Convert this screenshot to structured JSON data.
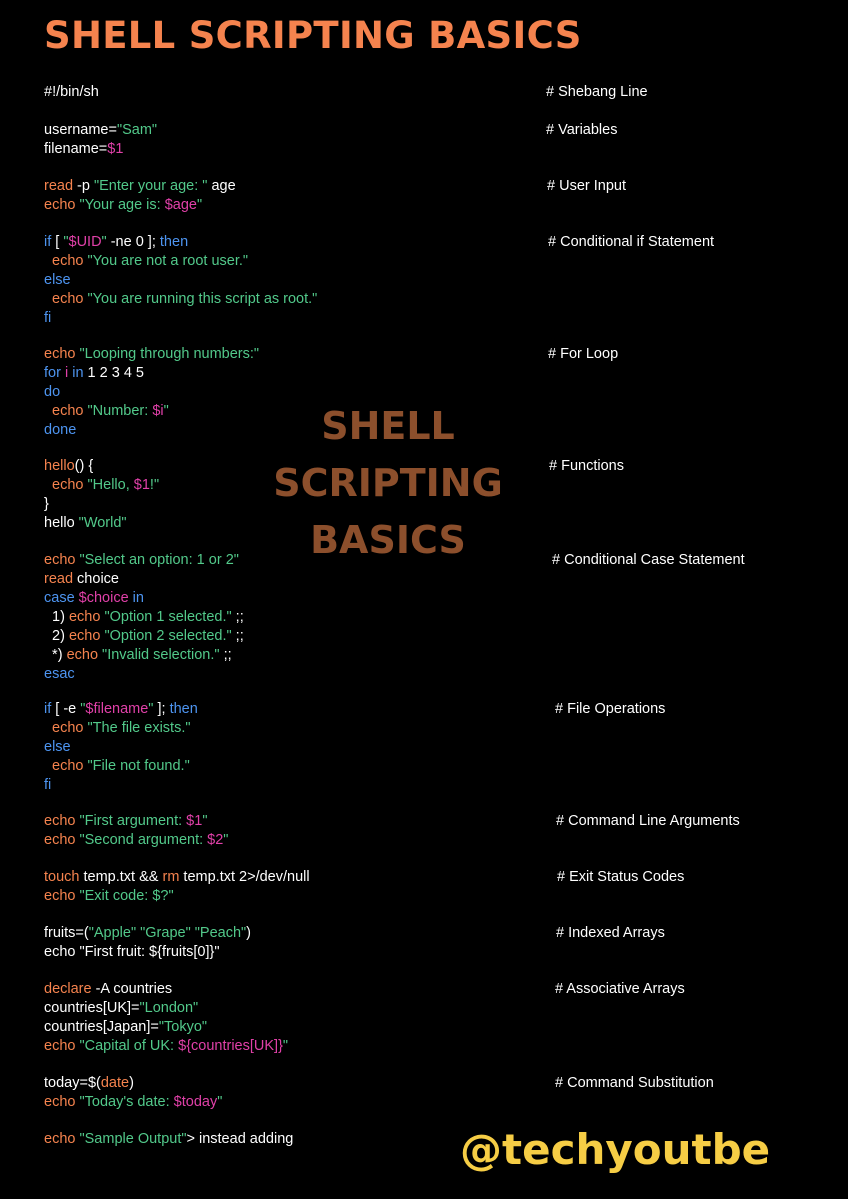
{
  "title": "SHELL SCRIPTING BASICS",
  "watermark": [
    "SHELL",
    "SCRIPTING",
    "BASICS"
  ],
  "handle": "@techyoutbe",
  "colors": {
    "background": "#000000",
    "title": "#f5834e",
    "plain": "#ffffff",
    "command": "#f5834e",
    "string": "#52c98a",
    "variable": "#e040a8",
    "keyword": "#4d94f0",
    "watermark": "#8c4f2c",
    "handle": "#f6cd45"
  },
  "code_lines": [
    {
      "name": "shebang",
      "segments": [
        [
          "w",
          "#!/bin/sh"
        ]
      ]
    },
    {
      "name": "var-username",
      "segments": [
        [
          "w",
          "username="
        ],
        [
          "g",
          "\"Sam\""
        ]
      ]
    },
    {
      "name": "var-filename",
      "segments": [
        [
          "w",
          "filename="
        ],
        [
          "m",
          "$1"
        ]
      ]
    },
    {
      "name": "read-age",
      "segments": [
        [
          "o",
          "read"
        ],
        [
          "w",
          " -p "
        ],
        [
          "g",
          "\"Enter your age: \""
        ],
        [
          "w",
          " age"
        ]
      ]
    },
    {
      "name": "echo-age",
      "segments": [
        [
          "o",
          "echo "
        ],
        [
          "g",
          "\"Your age is: "
        ],
        [
          "m",
          "$age"
        ],
        [
          "g",
          "\""
        ]
      ]
    },
    {
      "name": "if-uid",
      "segments": [
        [
          "b",
          "if"
        ],
        [
          "w",
          " [ "
        ],
        [
          "g",
          "\""
        ],
        [
          "m",
          "$UID"
        ],
        [
          "g",
          "\""
        ],
        [
          "w",
          " -ne 0 ]; "
        ],
        [
          "b",
          "then"
        ]
      ]
    },
    {
      "name": "echo-not-root",
      "segments": [
        [
          "o",
          "  echo "
        ],
        [
          "g",
          "\"You are not a root user.\""
        ]
      ]
    },
    {
      "name": "else-1",
      "segments": [
        [
          "b",
          "else"
        ]
      ]
    },
    {
      "name": "echo-root",
      "segments": [
        [
          "o",
          "  echo "
        ],
        [
          "g",
          "\"You are running this script as root.\""
        ]
      ]
    },
    {
      "name": "fi-1",
      "segments": [
        [
          "b",
          "fi"
        ]
      ]
    },
    {
      "name": "echo-looping",
      "segments": [
        [
          "o",
          "echo "
        ],
        [
          "g",
          "\"Looping through numbers:\""
        ]
      ]
    },
    {
      "name": "for-loop",
      "segments": [
        [
          "b",
          "for"
        ],
        [
          "w",
          " "
        ],
        [
          "m",
          "i"
        ],
        [
          "w",
          " "
        ],
        [
          "b",
          "in"
        ],
        [
          "w",
          " 1 2 3 4 5"
        ]
      ]
    },
    {
      "name": "do",
      "segments": [
        [
          "b",
          "do"
        ]
      ]
    },
    {
      "name": "echo-number",
      "segments": [
        [
          "o",
          "  echo "
        ],
        [
          "g",
          "\"Number: "
        ],
        [
          "m",
          "$i"
        ],
        [
          "g",
          "\""
        ]
      ]
    },
    {
      "name": "done",
      "segments": [
        [
          "b",
          "done"
        ]
      ]
    },
    {
      "name": "func-hello",
      "segments": [
        [
          "o",
          "hello"
        ],
        [
          "w",
          "() {"
        ]
      ]
    },
    {
      "name": "echo-hello",
      "segments": [
        [
          "o",
          "  echo "
        ],
        [
          "g",
          "\"Hello, "
        ],
        [
          "m",
          "$1"
        ],
        [
          "g",
          "!\""
        ]
      ]
    },
    {
      "name": "close-brace",
      "segments": [
        [
          "w",
          "}"
        ]
      ]
    },
    {
      "name": "call-hello",
      "segments": [
        [
          "w",
          "hello "
        ],
        [
          "g",
          "\"World\""
        ]
      ]
    },
    {
      "name": "echo-select",
      "segments": [
        [
          "o",
          "echo "
        ],
        [
          "g",
          "\"Select an option: 1 or 2\""
        ]
      ]
    },
    {
      "name": "read-choice",
      "segments": [
        [
          "o",
          "read"
        ],
        [
          "w",
          " choice"
        ]
      ]
    },
    {
      "name": "case",
      "segments": [
        [
          "b",
          "case "
        ],
        [
          "m",
          "$choice"
        ],
        [
          "b",
          " in"
        ]
      ]
    },
    {
      "name": "case-1",
      "segments": [
        [
          "w",
          "  1) "
        ],
        [
          "o",
          "echo "
        ],
        [
          "g",
          "\"Option 1 selected.\""
        ],
        [
          "w",
          " ;;"
        ]
      ]
    },
    {
      "name": "case-2",
      "segments": [
        [
          "w",
          "  2) "
        ],
        [
          "o",
          "echo "
        ],
        [
          "g",
          "\"Option 2 selected.\""
        ],
        [
          "w",
          " ;;"
        ]
      ]
    },
    {
      "name": "case-default",
      "segments": [
        [
          "w",
          "  *) "
        ],
        [
          "o",
          "echo "
        ],
        [
          "g",
          "\"Invalid selection.\""
        ],
        [
          "w",
          " ;;"
        ]
      ]
    },
    {
      "name": "esac",
      "segments": [
        [
          "b",
          "esac"
        ]
      ]
    },
    {
      "name": "if-file",
      "segments": [
        [
          "b",
          "if"
        ],
        [
          "w",
          " [ -e "
        ],
        [
          "g",
          "\""
        ],
        [
          "m",
          "$filename"
        ],
        [
          "g",
          "\""
        ],
        [
          "w",
          " ]; "
        ],
        [
          "b",
          "then"
        ]
      ]
    },
    {
      "name": "echo-exists",
      "segments": [
        [
          "o",
          "  echo "
        ],
        [
          "g",
          "\"The file exists.\""
        ]
      ]
    },
    {
      "name": "else-2",
      "segments": [
        [
          "b",
          "else"
        ]
      ]
    },
    {
      "name": "echo-not-found",
      "segments": [
        [
          "o",
          "  echo "
        ],
        [
          "g",
          "\"File not found.\""
        ]
      ]
    },
    {
      "name": "fi-2",
      "segments": [
        [
          "b",
          "fi"
        ]
      ]
    },
    {
      "name": "echo-first-arg",
      "segments": [
        [
          "o",
          "echo "
        ],
        [
          "g",
          "\"First argument: "
        ],
        [
          "m",
          "$1"
        ],
        [
          "g",
          "\""
        ]
      ]
    },
    {
      "name": "echo-second-arg",
      "segments": [
        [
          "o",
          "echo "
        ],
        [
          "g",
          "\"Second argument: "
        ],
        [
          "m",
          "$2"
        ],
        [
          "g",
          "\""
        ]
      ]
    },
    {
      "name": "touch-rm",
      "segments": [
        [
          "o",
          "touch"
        ],
        [
          "w",
          " temp.txt && "
        ],
        [
          "o",
          "rm"
        ],
        [
          "w",
          " temp.txt 2>/dev/null"
        ]
      ]
    },
    {
      "name": "echo-exit-code",
      "segments": [
        [
          "o",
          "echo "
        ],
        [
          "g",
          "\"Exit code: $?\""
        ]
      ]
    },
    {
      "name": "fruits-array",
      "segments": [
        [
          "w",
          "fruits=("
        ],
        [
          "g",
          "\"Apple\" \"Grape\" \"Peach\""
        ],
        [
          "w",
          ")"
        ]
      ]
    },
    {
      "name": "echo-first-fruit",
      "segments": [
        [
          "w",
          "echo \"First fruit: ${fruits[0]}\""
        ]
      ]
    },
    {
      "name": "declare",
      "segments": [
        [
          "o",
          "declare"
        ],
        [
          "w",
          " -A countries"
        ]
      ]
    },
    {
      "name": "countries-uk",
      "segments": [
        [
          "w",
          "countries[UK]="
        ],
        [
          "g",
          "\"London\""
        ]
      ]
    },
    {
      "name": "countries-japan",
      "segments": [
        [
          "w",
          "countries[Japan]="
        ],
        [
          "g",
          "\"Tokyo\""
        ]
      ]
    },
    {
      "name": "echo-capital",
      "segments": [
        [
          "o",
          "echo "
        ],
        [
          "g",
          "\"Capital of UK: "
        ],
        [
          "m",
          "${countries[UK]}"
        ],
        [
          "g",
          "\""
        ]
      ]
    },
    {
      "name": "today",
      "segments": [
        [
          "w",
          "today=$("
        ],
        [
          "o",
          "date"
        ],
        [
          "w",
          ")"
        ]
      ]
    },
    {
      "name": "echo-today",
      "segments": [
        [
          "o",
          "echo "
        ],
        [
          "g",
          "\"Today's date: "
        ],
        [
          "m",
          "$today"
        ],
        [
          "g",
          "\""
        ]
      ]
    },
    {
      "name": "echo-sample",
      "segments": [
        [
          "o",
          "echo "
        ],
        [
          "g",
          "\"Sample Output\""
        ],
        [
          "w",
          "> instead adding"
        ]
      ]
    }
  ],
  "comments": [
    {
      "name": "comment-shebang",
      "text": "# Shebang Line"
    },
    {
      "name": "comment-variables",
      "text": "# Variables"
    },
    {
      "name": "comment-user-input",
      "text": "# User Input"
    },
    {
      "name": "comment-conditional-if",
      "text": "# Conditional if Statement"
    },
    {
      "name": "comment-for-loop",
      "text": "# For Loop"
    },
    {
      "name": "comment-functions",
      "text": "# Functions"
    },
    {
      "name": "comment-conditional-case",
      "text": "# Conditional Case Statement"
    },
    {
      "name": "comment-file-operations",
      "text": "# File Operations"
    },
    {
      "name": "comment-command-line-args",
      "text": "# Command Line Arguments"
    },
    {
      "name": "comment-exit-status",
      "text": "# Exit Status Codes"
    },
    {
      "name": "comment-indexed-arrays",
      "text": "# Indexed Arrays"
    },
    {
      "name": "comment-associative-arrays",
      "text": "# Associative Arrays"
    },
    {
      "name": "comment-command-substitution",
      "text": "# Command Substitution"
    }
  ]
}
